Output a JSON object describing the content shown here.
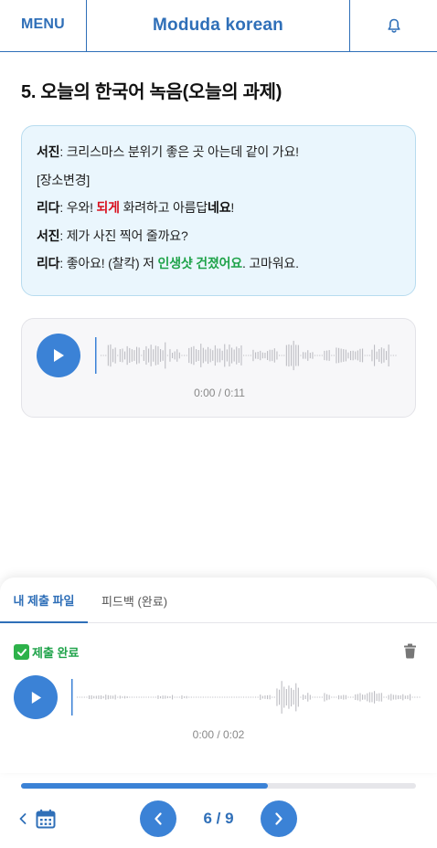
{
  "header": {
    "menu_label": "MENU",
    "logo_text": "Moduda korean",
    "bell_icon": "bell-icon",
    "accent_color": "#2f6fb8"
  },
  "section": {
    "title": "5. 오늘의 한국어 녹음(오늘의 과제)"
  },
  "dialogue": {
    "lines": [
      {
        "speaker": "서진",
        "segments": [
          {
            "text": ": 크리스마스 분위기 좋은 곳 아는데 같이 가요!",
            "style": "normal"
          }
        ]
      },
      {
        "speaker": "",
        "segments": [
          {
            "text": "[장소변경]",
            "style": "normal"
          }
        ]
      },
      {
        "speaker": "리다",
        "segments": [
          {
            "text": ": 우와! ",
            "style": "normal"
          },
          {
            "text": "되게",
            "style": "red"
          },
          {
            "text": " 화려하고 아름답",
            "style": "normal"
          },
          {
            "text": "네요",
            "style": "bold"
          },
          {
            "text": "!",
            "style": "normal"
          }
        ]
      },
      {
        "speaker": "서진",
        "segments": [
          {
            "text": ": 제가 사진 찍어 줄까요?",
            "style": "normal"
          }
        ]
      },
      {
        "speaker": "리다",
        "segments": [
          {
            "text": ": 좋아요! (찰칵) 저 ",
            "style": "normal"
          },
          {
            "text": "인생샷 건졌어요",
            "style": "green"
          },
          {
            "text": ". 고마워요.",
            "style": "normal"
          }
        ]
      }
    ]
  },
  "main_player": {
    "play_icon": "play-icon",
    "time": "0:00 / 0:11",
    "progress": 0.0
  },
  "submission": {
    "tabs": [
      {
        "label": "내 제출 파일",
        "active": true
      },
      {
        "label": "피드백 (완료)",
        "active": false
      }
    ],
    "status_icon": "check-icon",
    "status_text": "제출 완료",
    "delete_icon": "trash-icon",
    "player": {
      "play_icon": "play-icon",
      "time": "0:00 / 0:02",
      "progress": 0.0
    }
  },
  "bottom_nav": {
    "progress": 0.625,
    "back_icon": "chevron-left-icon",
    "calendar_icon": "calendar-icon",
    "prev_icon": "chevron-left-icon",
    "next_icon": "chevron-right-icon",
    "current_page": 6,
    "total_pages": 9,
    "page_text": "6 / 9"
  }
}
